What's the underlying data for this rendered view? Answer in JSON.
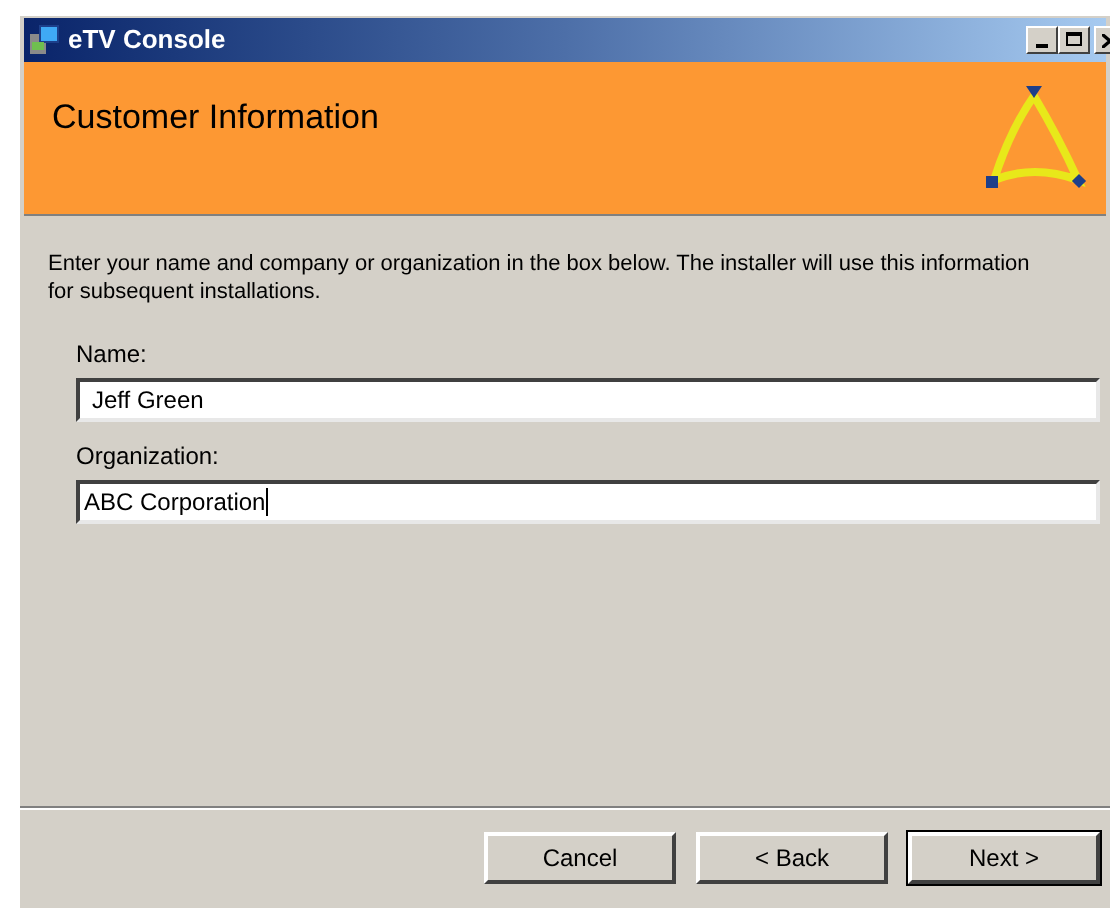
{
  "window": {
    "title": "eTV Console"
  },
  "header": {
    "title": "Customer Information"
  },
  "intro": "Enter your name and company or organization in the box below. The installer will use this information for subsequent installations.",
  "fields": [
    {
      "label": "Name:",
      "value": "Jeff Green",
      "focused": false
    },
    {
      "label": "Organization:",
      "value": "ABC Corporation",
      "focused": true
    }
  ],
  "buttons": [
    {
      "label": "Cancel",
      "default": false
    },
    {
      "label": "< Back",
      "default": false
    },
    {
      "label": "Next >",
      "default": true
    }
  ]
}
